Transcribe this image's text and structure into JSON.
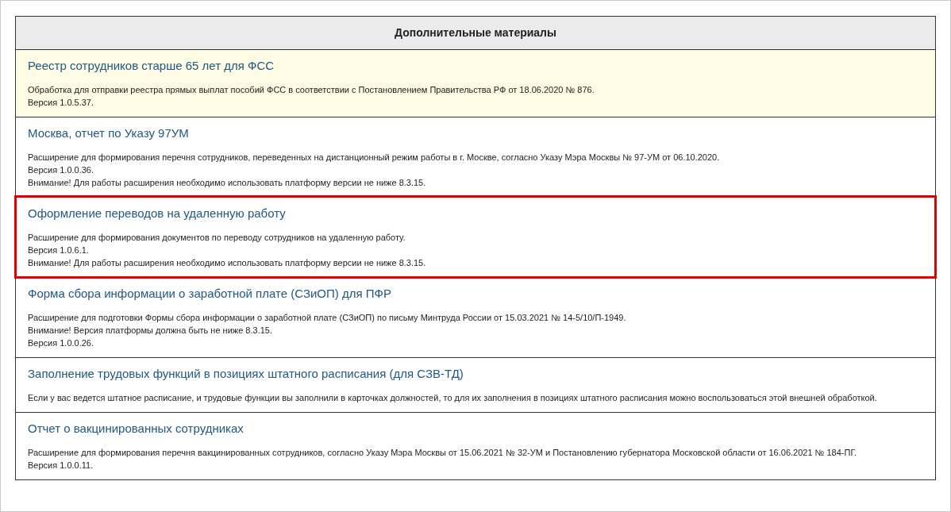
{
  "table": {
    "heading": "Дополнительные материалы",
    "items": [
      {
        "title": "Реестр сотрудников старше 65 лет для ФСС",
        "highlighted": true,
        "outlined": false,
        "lines": [
          "Обработка для отправки реестра прямых выплат пособий ФСС в соответствии с Постановлением Правительства РФ от 18.06.2020 № 876.",
          "Версия 1.0.5.37."
        ]
      },
      {
        "title": "Москва, отчет по Указу 97УМ",
        "highlighted": false,
        "outlined": false,
        "lines": [
          "Расширение для формирования перечня сотрудников, переведенных на дистанционный режим работы в г. Москве, согласно Указу Мэра Москвы № 97-УМ от 06.10.2020.",
          "Версия 1.0.0.36.",
          "Внимание! Для работы расширения необходимо использовать платформу версии не ниже 8.3.15."
        ]
      },
      {
        "title": "Оформление переводов на удаленную работу",
        "highlighted": false,
        "outlined": true,
        "lines": [
          "Расширение для формирования документов по переводу сотрудников на удаленную работу.",
          "Версия 1.0.6.1.",
          "Внимание! Для работы расширения необходимо использовать платформу версии не ниже 8.3.15."
        ]
      },
      {
        "title": "Форма сбора информации о заработной плате (СЗиОП) для ПФР",
        "highlighted": false,
        "outlined": false,
        "lines": [
          "Расширение для подготовки Формы сбора информации о заработной плате (СЗиОП) по письму Минтруда России от 15.03.2021 № 14-5/10/П-1949.",
          "Внимание! Версия платформы должна быть не ниже 8.3.15.",
          "Версия 1.0.0.26."
        ]
      },
      {
        "title": "Заполнение трудовых функций в позициях штатного расписания (для СЗВ-ТД)",
        "highlighted": false,
        "outlined": false,
        "lines": [
          "Если у вас ведется штатное расписание, и трудовые функции вы заполнили в карточках должностей, то для их заполнения в позициях штатного расписания можно воспользоваться этой внешней обработкой."
        ]
      },
      {
        "title": "Отчет о вакцинированных сотрудниках",
        "highlighted": false,
        "outlined": false,
        "lines": [
          "Расширение для формирования перечня вакцинированных сотрудников, согласно Указу Мэра Москвы от 15.06.2021 № 32-УМ и Постановлению губернатора Московской области от 16.06.2021 № 184-ПГ.",
          "Версия 1.0.0.11."
        ]
      }
    ]
  }
}
